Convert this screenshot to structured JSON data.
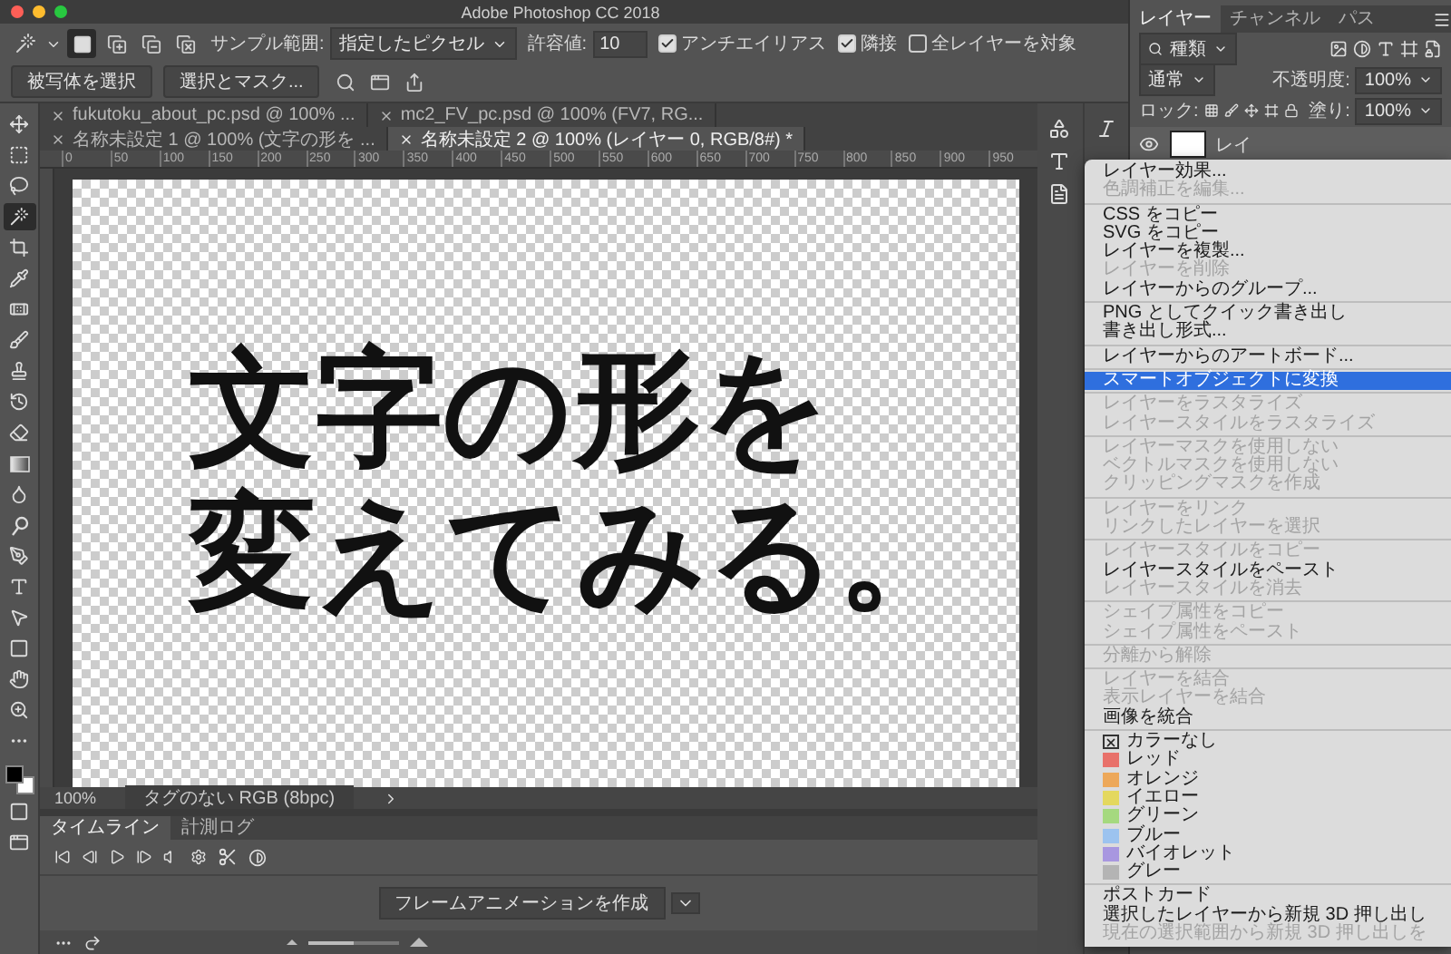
{
  "window": {
    "title": "Adobe Photoshop CC 2018"
  },
  "options_bar": {
    "sample_label": "サンプル範囲:",
    "sample_value": "指定したピクセル",
    "tolerance_label": "許容値:",
    "tolerance_value": "10",
    "checkboxes": [
      {
        "label": "アンチエイリアス",
        "checked": true
      },
      {
        "label": "隣接",
        "checked": true
      },
      {
        "label": "全レイヤーを対象",
        "checked": false
      }
    ],
    "buttons": [
      "被写体を選択",
      "選択とマスク..."
    ]
  },
  "tools": [
    {
      "kind": "move",
      "selected": false
    },
    {
      "kind": "marquee",
      "selected": false
    },
    {
      "kind": "lasso",
      "selected": false
    },
    {
      "kind": "wand",
      "selected": true
    },
    {
      "kind": "crop",
      "selected": false
    },
    {
      "kind": "eyedropper",
      "selected": false
    },
    {
      "kind": "healing",
      "selected": false
    },
    {
      "kind": "brush",
      "selected": false
    },
    {
      "kind": "stamp",
      "selected": false
    },
    {
      "kind": "history",
      "selected": false
    },
    {
      "kind": "eraser",
      "selected": false
    },
    {
      "kind": "gradient",
      "selected": false
    },
    {
      "kind": "blur",
      "selected": false
    },
    {
      "kind": "dodge",
      "selected": false
    },
    {
      "kind": "pen",
      "selected": false
    },
    {
      "kind": "text",
      "selected": false
    },
    {
      "kind": "path",
      "selected": false
    },
    {
      "kind": "shape",
      "selected": false
    },
    {
      "kind": "hand",
      "selected": false
    },
    {
      "kind": "zoom",
      "selected": false
    },
    {
      "kind": "more",
      "selected": false
    }
  ],
  "document_tabs": [
    {
      "label": "fukutoku_about_pc.psd @ 100% ...",
      "selected": false
    },
    {
      "label": "mc2_FV_pc.psd @ 100% (FV7, RG...",
      "selected": false
    },
    {
      "label": "名称未設定 1 @ 100% (文字の形を ...",
      "selected": false
    },
    {
      "label": "名称未設定 2 @ 100% (レイヤー 0, RGB/8#) *",
      "selected": true
    }
  ],
  "ruler": {
    "labels": [
      "0",
      "50",
      "100",
      "150",
      "200",
      "250",
      "300",
      "350",
      "400",
      "450",
      "500",
      "550",
      "600",
      "650",
      "700",
      "750",
      "800",
      "850",
      "900",
      "950"
    ]
  },
  "canvas": {
    "lines": [
      "文字の形を",
      "変えてみる。"
    ]
  },
  "status_bar": {
    "zoom": "100%",
    "profile": "タグのない RGB (8bpc)"
  },
  "timeline": {
    "tabs": [
      {
        "label": "タイムライン",
        "selected": true
      },
      {
        "label": "計測ログ",
        "selected": false
      }
    ],
    "create_button": "フレームアニメーションを作成",
    "zoom_slider": {
      "level": 0.5
    }
  },
  "layers_panel": {
    "tabs": [
      {
        "label": "レイヤー",
        "selected": true
      },
      {
        "label": "チャンネル",
        "selected": false
      },
      {
        "label": "パス",
        "selected": false
      }
    ],
    "filter": "種類",
    "blend_mode": "通常",
    "opacity_label": "不透明度:",
    "opacity": "100%",
    "lock_label": "ロック:",
    "fill_label": "塗り:",
    "fill": "100%",
    "layers": [
      {
        "name": "レイ",
        "visible": true
      }
    ]
  },
  "context_menu": {
    "items": [
      {
        "kind": "item",
        "label": "レイヤー効果...",
        "disabled": false,
        "selected": false
      },
      {
        "kind": "item",
        "label": "色調補正を編集...",
        "disabled": true,
        "selected": false
      },
      {
        "kind": "separator"
      },
      {
        "kind": "item",
        "label": "CSS をコピー",
        "disabled": false,
        "selected": false
      },
      {
        "kind": "item",
        "label": "SVG をコピー",
        "disabled": false,
        "selected": false
      },
      {
        "kind": "item",
        "label": "レイヤーを複製...",
        "disabled": false,
        "selected": false
      },
      {
        "kind": "item",
        "label": "レイヤーを削除",
        "disabled": true,
        "selected": false
      },
      {
        "kind": "item",
        "label": "レイヤーからのグループ...",
        "disabled": false,
        "selected": false
      },
      {
        "kind": "separator"
      },
      {
        "kind": "item",
        "label": "PNG としてクイック書き出し",
        "disabled": false,
        "selected": false
      },
      {
        "kind": "item",
        "label": "書き出し形式...",
        "disabled": false,
        "selected": false
      },
      {
        "kind": "separator"
      },
      {
        "kind": "item",
        "label": "レイヤーからのアートボード...",
        "disabled": false,
        "selected": false
      },
      {
        "kind": "separator"
      },
      {
        "kind": "item",
        "label": "スマートオブジェクトに変換",
        "disabled": false,
        "selected": true
      },
      {
        "kind": "separator"
      },
      {
        "kind": "item",
        "label": "レイヤーをラスタライズ",
        "disabled": true,
        "selected": false
      },
      {
        "kind": "item",
        "label": "レイヤースタイルをラスタライズ",
        "disabled": true,
        "selected": false
      },
      {
        "kind": "separator"
      },
      {
        "kind": "item",
        "label": "レイヤーマスクを使用しない",
        "disabled": true,
        "selected": false
      },
      {
        "kind": "item",
        "label": "ベクトルマスクを使用しない",
        "disabled": true,
        "selected": false
      },
      {
        "kind": "item",
        "label": "クリッピングマスクを作成",
        "disabled": true,
        "selected": false
      },
      {
        "kind": "separator"
      },
      {
        "kind": "item",
        "label": "レイヤーをリンク",
        "disabled": true,
        "selected": false
      },
      {
        "kind": "item",
        "label": "リンクしたレイヤーを選択",
        "disabled": true,
        "selected": false
      },
      {
        "kind": "separator"
      },
      {
        "kind": "item",
        "label": "レイヤースタイルをコピー",
        "disabled": true,
        "selected": false
      },
      {
        "kind": "item",
        "label": "レイヤースタイルをペースト",
        "disabled": false,
        "selected": false
      },
      {
        "kind": "item",
        "label": "レイヤースタイルを消去",
        "disabled": true,
        "selected": false
      },
      {
        "kind": "separator"
      },
      {
        "kind": "item",
        "label": "シェイプ属性をコピー",
        "disabled": true,
        "selected": false
      },
      {
        "kind": "item",
        "label": "シェイプ属性をペースト",
        "disabled": true,
        "selected": false
      },
      {
        "kind": "separator"
      },
      {
        "kind": "item",
        "label": "分離から解除",
        "disabled": true,
        "selected": false
      },
      {
        "kind": "separator"
      },
      {
        "kind": "item",
        "label": "レイヤーを結合",
        "disabled": true,
        "selected": false
      },
      {
        "kind": "item",
        "label": "表示レイヤーを結合",
        "disabled": true,
        "selected": false
      },
      {
        "kind": "item",
        "label": "画像を統合",
        "disabled": false,
        "selected": false
      },
      {
        "kind": "separator"
      },
      {
        "kind": "no-color",
        "label": "カラーなし",
        "selected": false
      },
      {
        "kind": "color",
        "label": "レッド",
        "color": "#e8716a",
        "selected": false
      },
      {
        "kind": "color",
        "label": "オレンジ",
        "color": "#eda85a",
        "selected": false
      },
      {
        "kind": "color",
        "label": "イエロー",
        "color": "#e4d85e",
        "selected": false
      },
      {
        "kind": "color",
        "label": "グリーン",
        "color": "#a5d97f",
        "selected": false
      },
      {
        "kind": "color",
        "label": "ブルー",
        "color": "#9cc3ef",
        "selected": false
      },
      {
        "kind": "color",
        "label": "バイオレット",
        "color": "#a897e0",
        "selected": false
      },
      {
        "kind": "color",
        "label": "グレー",
        "color": "#b4b4b4",
        "selected": false
      },
      {
        "kind": "separator"
      },
      {
        "kind": "item",
        "label": "ポストカード",
        "disabled": false,
        "selected": false
      },
      {
        "kind": "item",
        "label": "選択したレイヤーから新規 3D 押し出し",
        "disabled": false,
        "selected": false
      },
      {
        "kind": "item",
        "label": "現在の選択範囲から新規 3D 押し出しを",
        "disabled": true,
        "selected": false
      }
    ]
  }
}
